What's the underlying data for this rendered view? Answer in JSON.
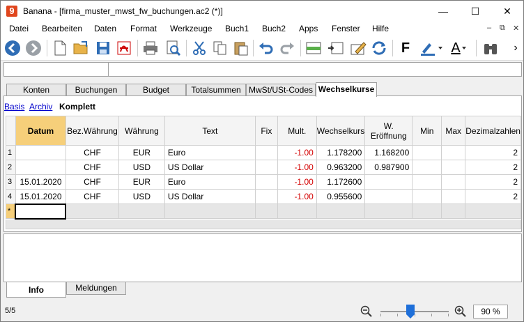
{
  "window": {
    "title": "Banana - [firma_muster_mwst_fw_buchungen.ac2 (*)]",
    "app_logo": "9",
    "minimize": "—",
    "maximize": "☐",
    "close": "✕"
  },
  "menu": {
    "items": [
      "Datei",
      "Bearbeiten",
      "Daten",
      "Format",
      "Werkzeuge",
      "Buch1",
      "Buch2",
      "Apps",
      "Fenster",
      "Hilfe"
    ],
    "mdi_minimize": "–",
    "mdi_restore": "⧉",
    "mdi_close": "✕"
  },
  "toolbar": {
    "icons": [
      "back-icon",
      "forward-icon",
      "new-file-icon",
      "open-folder-icon",
      "save-icon",
      "pdf-icon",
      "print-icon",
      "print-preview-icon",
      "cut-icon",
      "copy-icon",
      "paste-icon",
      "undo-icon",
      "redo-icon",
      "add-row-icon",
      "insert-row-icon",
      "edit-icon",
      "recheck-icon",
      "bold-icon",
      "highlight-icon",
      "font-color-icon",
      "binoculars-icon"
    ],
    "bold_label": "F",
    "font_color_label": "A",
    "more_label": "›"
  },
  "colors": {
    "accent": "#1e6fd9",
    "header_selected": "#f6cf7a",
    "negative": "#d40000",
    "link": "#0000cc"
  },
  "tabs": [
    "Konten",
    "Buchungen",
    "Budget",
    "Totalsummen",
    "MwSt/USt-Codes",
    "Wechselkurse"
  ],
  "active_tab": "Wechselkurse",
  "views": {
    "basis": "Basis",
    "archiv": "Archiv",
    "komplett": "Komplett"
  },
  "table": {
    "headers": {
      "datum": "Datum",
      "bez_waehrung": "Bez.Währung",
      "waehrung": "Währung",
      "text": "Text",
      "fix": "Fix",
      "mult": "Mult.",
      "wechselkurs": "Wechselkurs",
      "w_eroeffnung": "W. Eröffnung",
      "min": "Min",
      "max": "Max",
      "dezimalzahlen": "Dezimalzahlen"
    },
    "rows": [
      {
        "n": "1",
        "datum": "",
        "bez": "CHF",
        "waehrung": "EUR",
        "text": "Euro",
        "fix": "",
        "mult": "-1.00",
        "kurs": "1.178200",
        "eroeffnung": "1.168200",
        "min": "",
        "max": "",
        "dez": "2"
      },
      {
        "n": "2",
        "datum": "",
        "bez": "CHF",
        "waehrung": "USD",
        "text": "US Dollar",
        "fix": "",
        "mult": "-1.00",
        "kurs": "0.963200",
        "eroeffnung": "0.987900",
        "min": "",
        "max": "",
        "dez": "2"
      },
      {
        "n": "3",
        "datum": "15.01.2020",
        "bez": "CHF",
        "waehrung": "EUR",
        "text": "Euro",
        "fix": "",
        "mult": "-1.00",
        "kurs": "1.172600",
        "eroeffnung": "",
        "min": "",
        "max": "",
        "dez": "2"
      },
      {
        "n": "4",
        "datum": "15.01.2020",
        "bez": "CHF",
        "waehrung": "USD",
        "text": "US Dollar",
        "fix": "",
        "mult": "-1.00",
        "kurs": "0.955600",
        "eroeffnung": "",
        "min": "",
        "max": "",
        "dez": "2"
      }
    ],
    "new_row_marker": "*"
  },
  "bottom_tabs": [
    "Info",
    "Meldungen"
  ],
  "status": {
    "count": "5/5",
    "zoom": "90  %"
  }
}
